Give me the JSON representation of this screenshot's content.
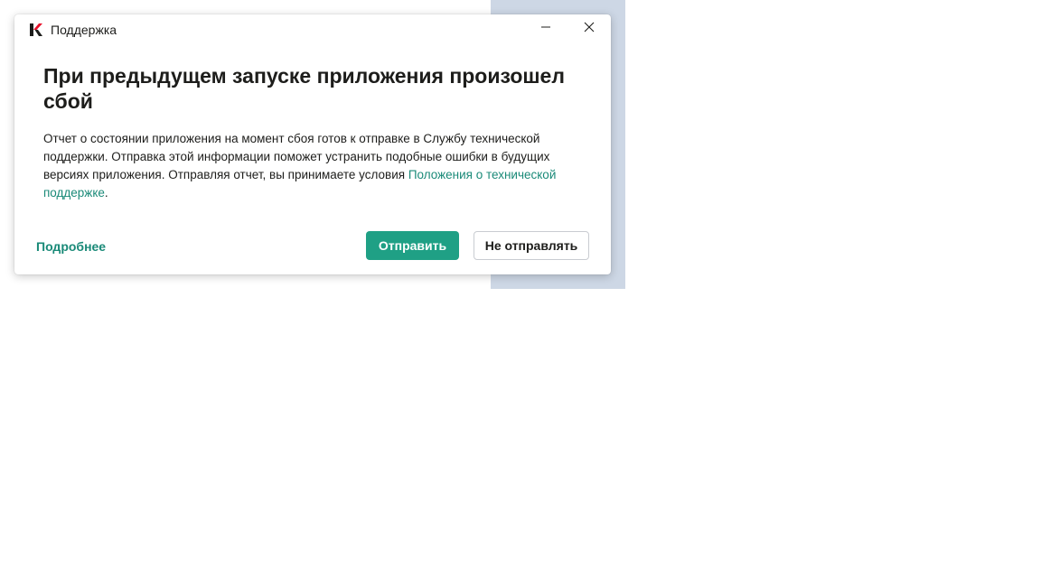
{
  "window": {
    "title": "Поддержка",
    "logo_icon": "kaspersky-k-logo-icon",
    "minimize_icon": "minimize-icon",
    "close_icon": "close-icon"
  },
  "dialog": {
    "heading": "При предыдущем запуске приложения произошел сбой",
    "body_text": "Отчет о состоянии приложения на момент сбоя готов к отправке в Службу технической поддержки. Отправка этой информации поможет устранить подобные ошибки в будущих версиях приложения. Отправляя отчет, вы принимаете условия ",
    "terms_link": "Положения о технической поддержке",
    "body_end": "."
  },
  "footer": {
    "more_link": "Подробнее",
    "send_button": "Отправить",
    "dont_send_button": "Не отправлять"
  },
  "colors": {
    "accent": "#1fa085",
    "link": "#1a8a78",
    "background_panel": "#cdd7e5",
    "logo_red": "#e8102a"
  }
}
